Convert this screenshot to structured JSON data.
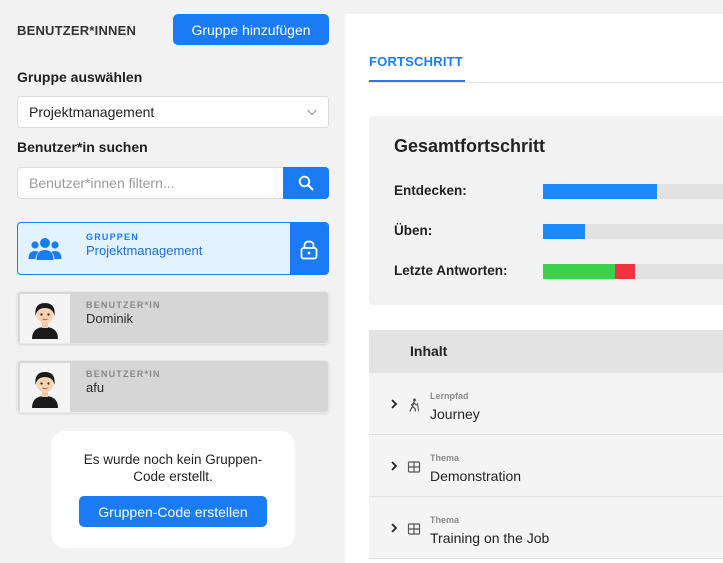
{
  "left": {
    "heading": "BENUTZER*INNEN",
    "add_group_label": "Gruppe hinzufügen",
    "select_group_label": "Gruppe auswählen",
    "selected_group": "Projektmanagement",
    "search_label": "Benutzer*in suchen",
    "search_placeholder": "Benutzer*innen filtern...",
    "group_card": {
      "kicker": "GRUPPEN",
      "name": "Projektmanagement"
    },
    "users": [
      {
        "kicker": "BENUTZER*IN",
        "name": "Dominik"
      },
      {
        "kicker": "BENUTZER*IN",
        "name": "afu"
      }
    ],
    "group_code_message": "Es wurde noch kein Gruppen-Code erstellt.",
    "create_code_label": "Gruppen-Code erstellen"
  },
  "right": {
    "tab": "FORTSCHRITT",
    "progress_title": "Gesamtfortschritt",
    "progress": [
      {
        "label": "Entdecken:",
        "segments": [
          {
            "color": "#1a8cff",
            "fraction": 0.57
          }
        ]
      },
      {
        "label": "Üben:",
        "segments": [
          {
            "color": "#1a8cff",
            "fraction": 0.21
          }
        ]
      },
      {
        "label": "Letzte Antworten:",
        "segments": [
          {
            "color": "#3bd14a",
            "fraction": 0.36
          },
          {
            "color": "#f0333f",
            "fraction": 0.1
          }
        ]
      }
    ],
    "content_header": "Inhalt",
    "content_rows": [
      {
        "kind": "Lernpfad",
        "title": "Journey",
        "icon": "hiker-icon"
      },
      {
        "kind": "Thema",
        "title": "Demonstration",
        "icon": "grid-icon"
      },
      {
        "kind": "Thema",
        "title": "Training on the Job",
        "icon": "grid-icon"
      }
    ]
  },
  "colors": {
    "accent": "#1a7cf4",
    "group_card_bg": "#e3f3fd",
    "user_card_bg": "#d6d6d6"
  }
}
